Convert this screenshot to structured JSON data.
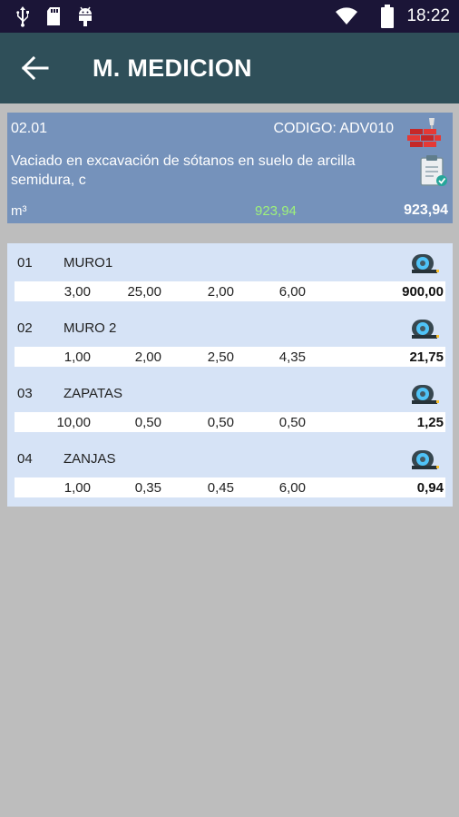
{
  "status_bar": {
    "time": "18:22",
    "icons": [
      "usb-icon",
      "sd-card-icon",
      "android-icon",
      "wifi-icon",
      "battery-icon"
    ]
  },
  "app_bar": {
    "title": "M. MEDICION",
    "back_icon": "arrow-left-icon"
  },
  "item": {
    "code": "02.01",
    "codigo": "CODIGO: ADV010",
    "description": "Vaciado en excavación de sótanos en suelo de arcilla semidura, c",
    "unit": "m³",
    "partial_quantity": "923,94",
    "total_quantity": "923,94",
    "partial_color": "#9ef27a"
  },
  "measurements": [
    {
      "num": "01",
      "name": "MURO1",
      "v1": "3,00",
      "v2": "25,00",
      "v3": "2,00",
      "v4": "6,00",
      "total": "900,00"
    },
    {
      "num": "02",
      "name": "MURO 2",
      "v1": "1,00",
      "v2": "2,00",
      "v3": "2,50",
      "v4": "4,35",
      "total": "21,75"
    },
    {
      "num": "03",
      "name": "ZAPATAS",
      "v1": "10,00",
      "v2": "0,50",
      "v3": "0,50",
      "v4": "0,50",
      "total": "1,25"
    },
    {
      "num": "04",
      "name": "ZANJAS",
      "v1": "1,00",
      "v2": "0,35",
      "v3": "0,45",
      "v4": "6,00",
      "total": "0,94"
    }
  ],
  "colors": {
    "status_bar": "#1b1537",
    "app_bar": "#2f4f59",
    "header_card": "#7592bb",
    "list_background": "#d6e3f6",
    "page_background": "#bdbdbd"
  }
}
